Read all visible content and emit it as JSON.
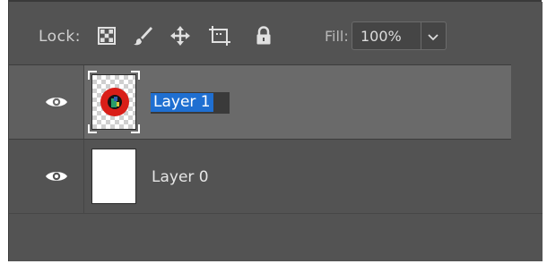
{
  "lockbar": {
    "lock_label": "Lock:",
    "lock_icons": [
      "lock-transparent-pixels-icon",
      "lock-image-pixels-icon",
      "lock-position-icon",
      "lock-artboard-icon",
      "lock-all-icon"
    ],
    "fill_label": "Fill:",
    "fill_value": "100%"
  },
  "layers": [
    {
      "name": "Layer 1",
      "visible": true,
      "selected": true,
      "editing_name": true,
      "thumbnail": "transparent-with-red-circle-icon"
    },
    {
      "name": "Layer 0",
      "visible": true,
      "selected": false,
      "editing_name": false,
      "thumbnail": "white-fill"
    }
  ],
  "colors": {
    "panel_bg": "#535353",
    "selected_row_bg": "#6a6a6a",
    "selection_highlight": "#1f6fd1",
    "thumbnail_icon_red": "#e02020"
  }
}
